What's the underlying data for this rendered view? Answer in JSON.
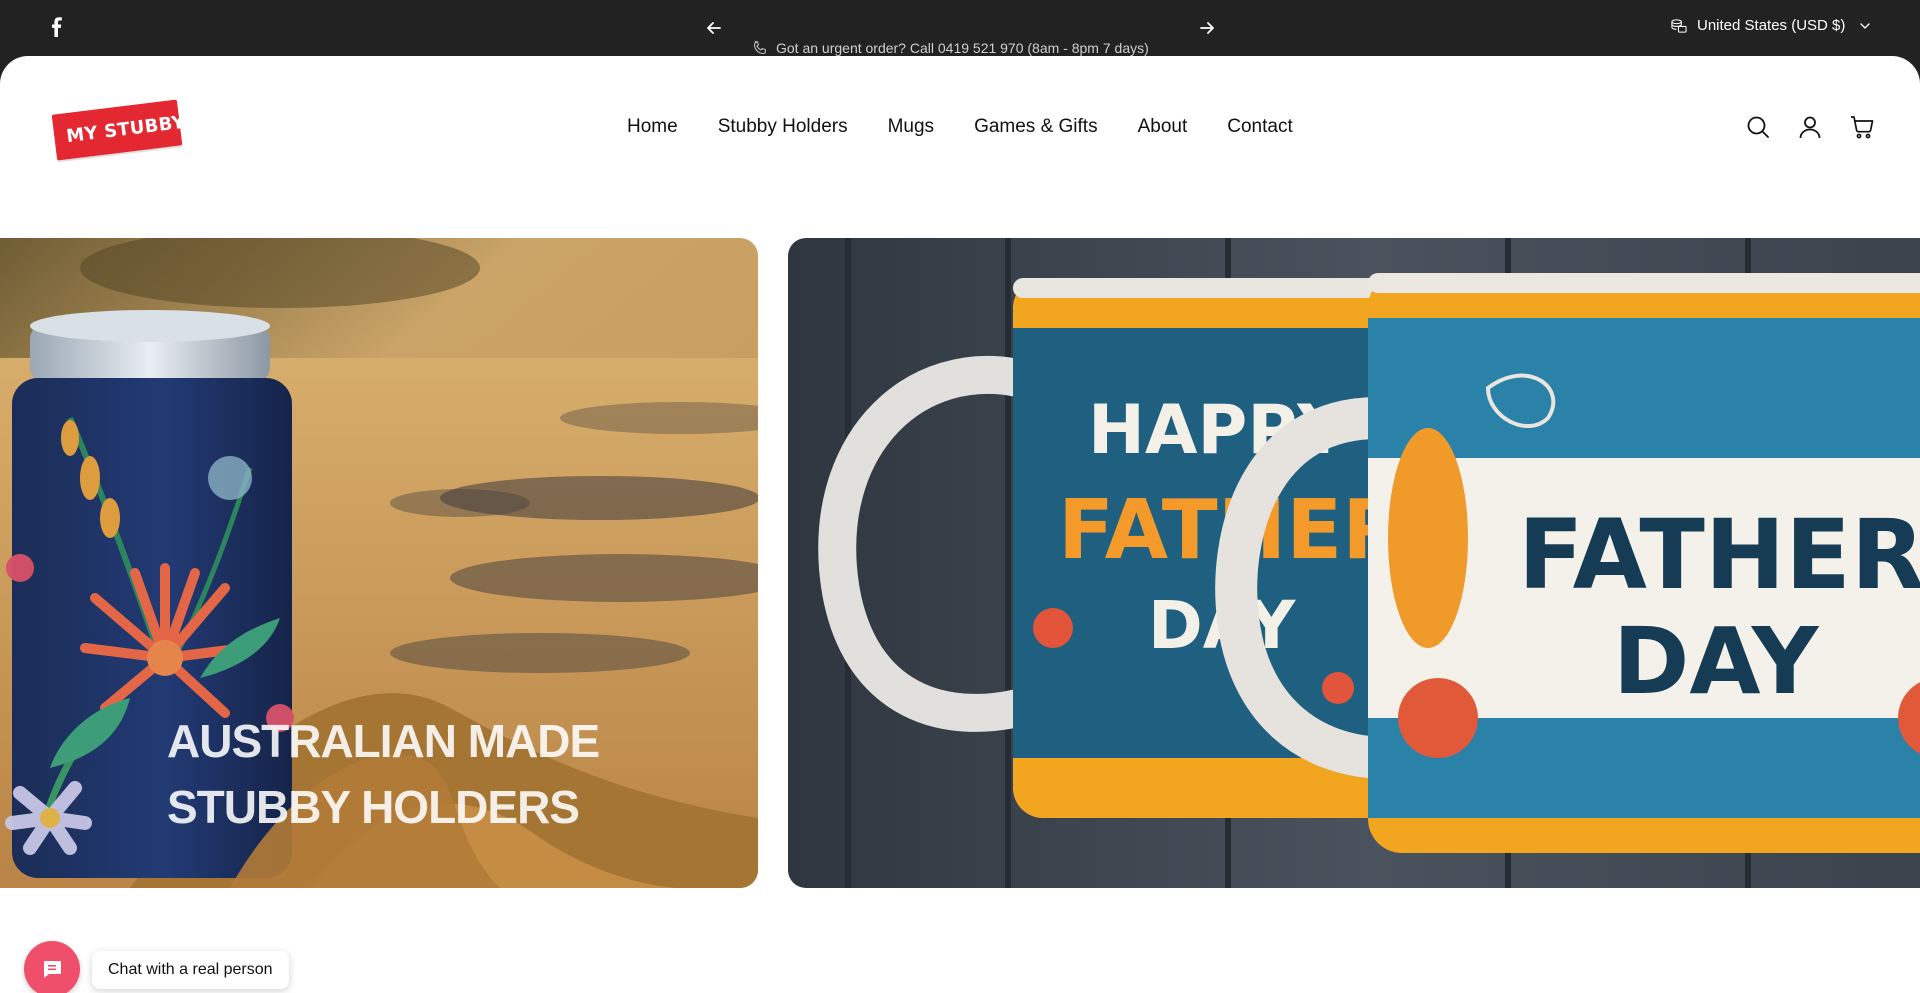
{
  "announcement": {
    "text": "Got an urgent order? Call 0419 521 970 (8am - 8pm 7 days)"
  },
  "currency": {
    "selected": "United States (USD $)"
  },
  "logo": {
    "text": "MY STUBBY",
    "color": "#e32831"
  },
  "nav": {
    "items": [
      {
        "label": "Home"
      },
      {
        "label": "Stubby Holders"
      },
      {
        "label": "Mugs"
      },
      {
        "label": "Games & Gifts"
      },
      {
        "label": "About"
      },
      {
        "label": "Contact"
      }
    ]
  },
  "header_icons": [
    "search-icon",
    "account-icon",
    "cart-icon"
  ],
  "hero": {
    "slides": [
      {
        "title": "AUSTRALIAN MADE STUBBY HOLDERS"
      },
      {
        "title": ""
      }
    ]
  },
  "chat": {
    "label": "Chat with a real person",
    "color": "#ef4f6b"
  }
}
